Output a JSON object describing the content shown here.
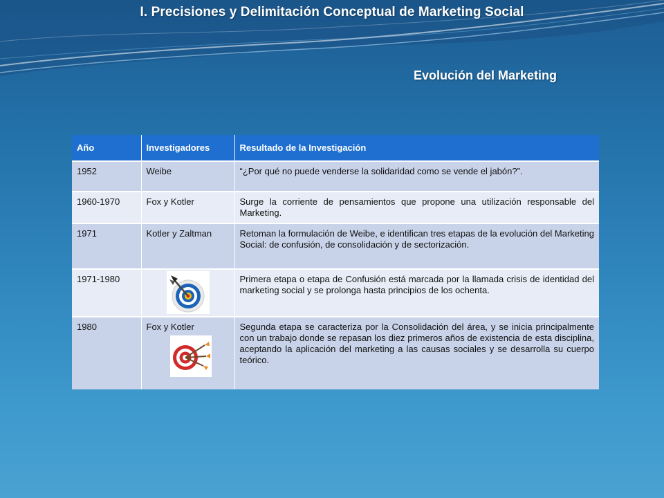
{
  "slide": {
    "title": "I. Precisiones y Delimitación Conceptual de Marketing Social",
    "subtitle": "Evolución del Marketing"
  },
  "table": {
    "headers": [
      "Año",
      "Investigadores",
      "Resultado de la Investigación"
    ],
    "rows": [
      {
        "year": "1952",
        "researchers": "Weibe",
        "result": "“¿Por qué no puede venderse la solidaridad como se vende el jabón?”."
      },
      {
        "year": "1960-1970",
        "researchers": "Fox y Kotler",
        "result": "Surge la corriente de pensamientos que propone una utilización responsable del Marketing."
      },
      {
        "year": "1971",
        "researchers": "Kotler y Zaltman",
        "result": "Retoman la formulación de Weibe, e identifican tres etapas de la evolución del Marketing Social: de confusión, de consolidación y de sectorización."
      },
      {
        "year": "1971-1980",
        "researchers": "",
        "result": "Primera etapa o etapa de Confusión está marcada por la llamada crisis de identidad del marketing social y se prolonga hasta principios de los ochenta.",
        "icon": "target-dart-blue-icon"
      },
      {
        "year": "1980",
        "researchers": "Fox y Kotler",
        "result": "Segunda etapa se caracteriza por la Consolidación del área, y se inicia principalmente con un trabajo donde se repasan los diez primeros años de existencia de esta disciplina, aceptando la aplicación del marketing a las causas sociales y se desarrolla su cuerpo teórico.",
        "icon": "target-arrows-red-icon"
      }
    ]
  },
  "colors": {
    "header_bg": "#1e6fd0",
    "row_odd": "#c8d3e9",
    "row_even": "#e7ecf6",
    "background": "#2f86bd"
  }
}
